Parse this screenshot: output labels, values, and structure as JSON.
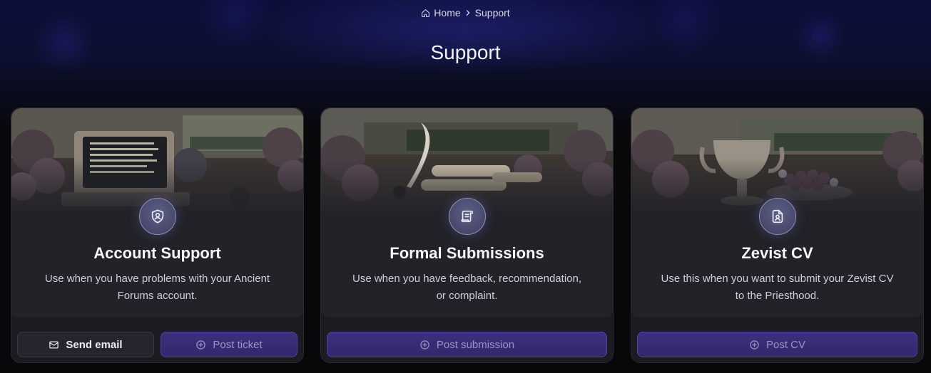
{
  "breadcrumb": {
    "home": "Home",
    "current": "Support"
  },
  "page": {
    "title": "Support"
  },
  "cards": [
    {
      "title": "Account Support",
      "description": "Use when you have problems with your Ancient Forums account.",
      "icon": "shield-user-icon",
      "image": "vintage computer in garden",
      "buttons": [
        {
          "label": "Send email",
          "icon": "mail-icon"
        },
        {
          "label": "Post ticket",
          "icon": "plus-circle-icon"
        }
      ]
    },
    {
      "title": "Formal Submissions",
      "description": "Use when you have feedback, recommendation, or complaint.",
      "icon": "scroll-icon",
      "image": "quill and scrolls",
      "buttons": [
        {
          "label": "Post submission",
          "icon": "plus-circle-icon"
        }
      ]
    },
    {
      "title": "Zevist CV",
      "description": "Use this when you want to submit your Zevist CV to the Priesthood.",
      "icon": "id-badge-icon",
      "image": "silver chalice and grapes",
      "buttons": [
        {
          "label": "Post CV",
          "icon": "plus-circle-icon"
        }
      ]
    }
  ],
  "colors": {
    "background": "#08080b",
    "card": "#1b1b21",
    "primary_button": "#3a2c77",
    "secondary_button": "#25252d"
  }
}
